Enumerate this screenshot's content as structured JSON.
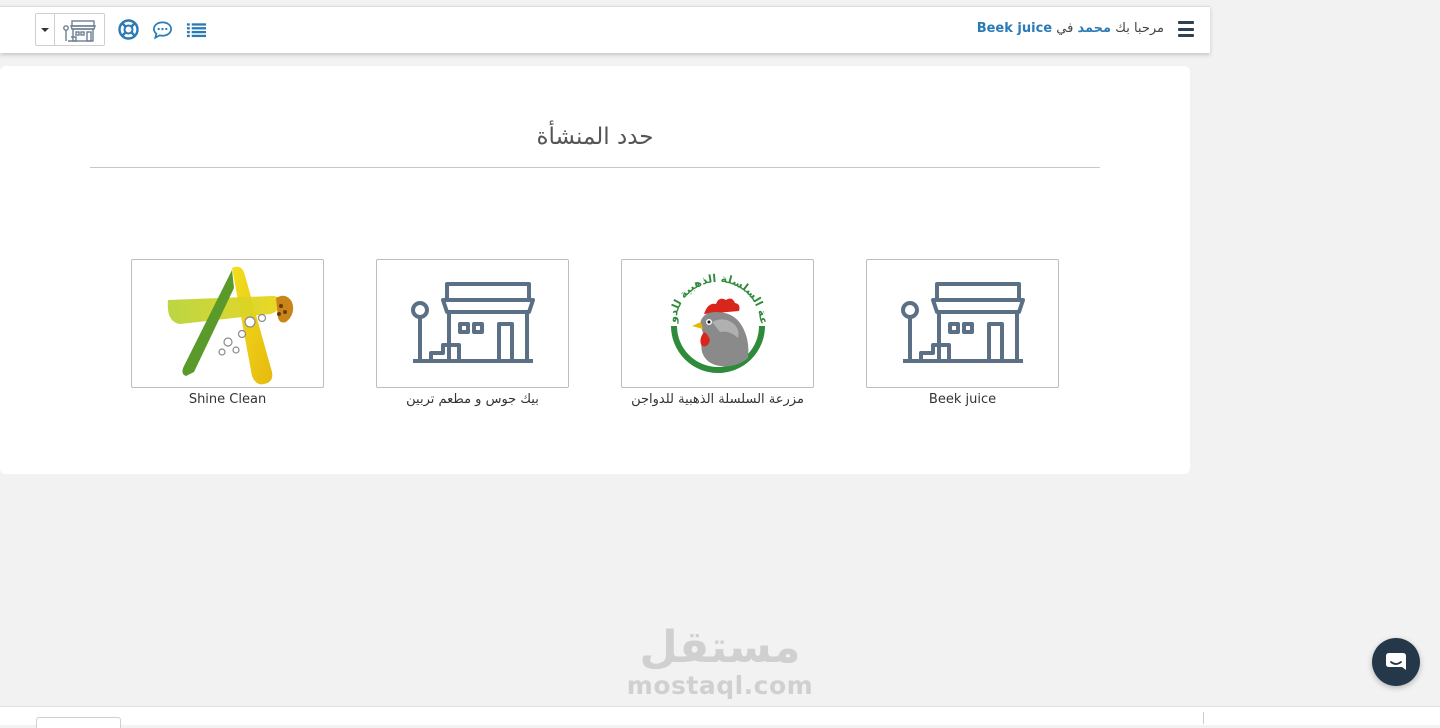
{
  "header": {
    "welcome_prefix": "مرحبا بك",
    "user_name": "محمد",
    "in_word": "في",
    "company_name": "Beek juice",
    "icons": [
      "menu-icon",
      "list-icon",
      "chat-icon",
      "support-icon",
      "store-icon",
      "caret-down-icon"
    ]
  },
  "panel": {
    "title": "حدد المنشأة"
  },
  "establishments": [
    {
      "name": "Beek juice",
      "logo": "store-icon"
    },
    {
      "name": "مزرعة السلسلة الذهبية للدواجن",
      "logo": "rooster-logo",
      "logo_text": "مزرعة السلسلة الذهبية للدواجن"
    },
    {
      "name": "بيك جوس و مطعم تربين",
      "logo": "store-icon"
    },
    {
      "name": "Shine Clean",
      "logo": "shine-clean-logo"
    }
  ],
  "watermark": {
    "arabic": "مستقل",
    "latin": "mostaql.com"
  },
  "colors": {
    "accent": "#2a7ab5",
    "dark": "#2f4152",
    "store_icon": "#5b6f85",
    "chat_button": "#24384a"
  }
}
